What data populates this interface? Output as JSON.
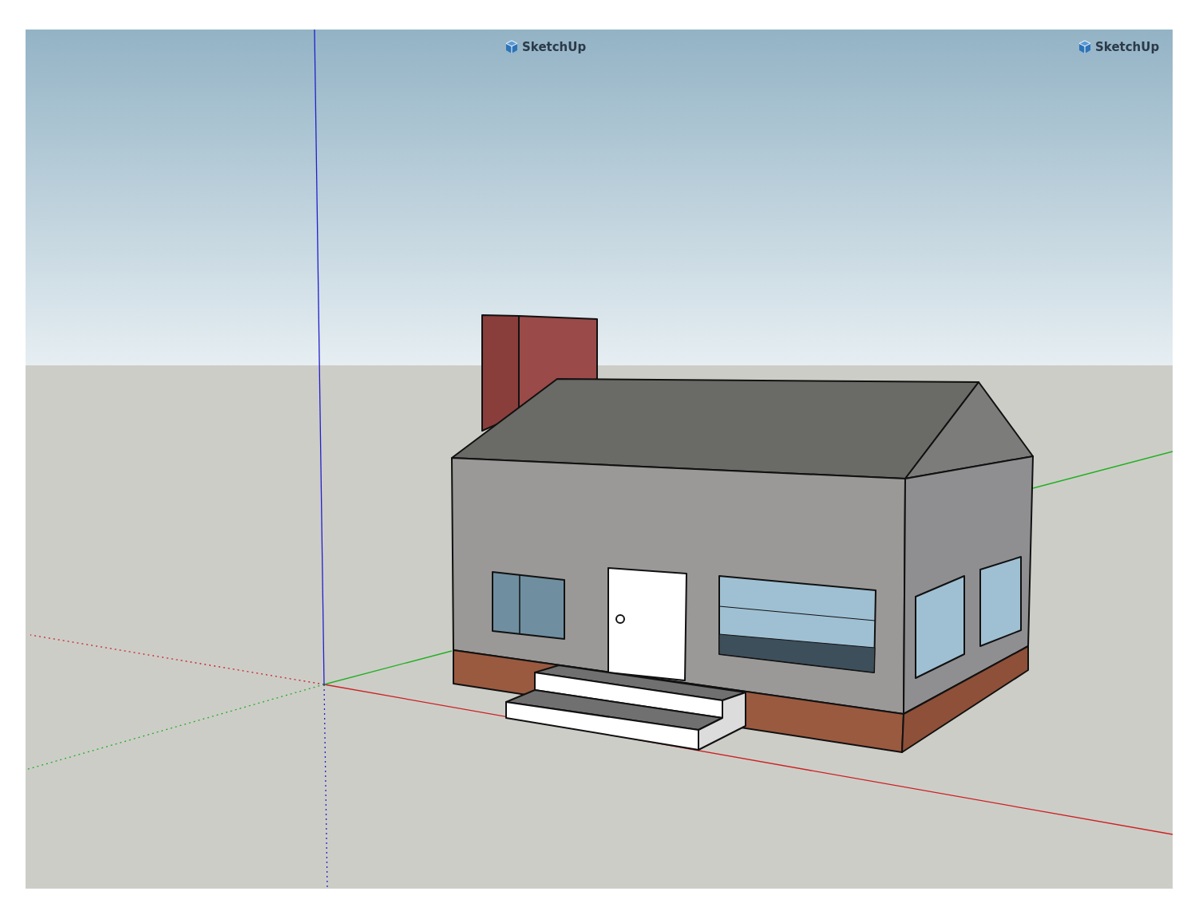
{
  "viewport": {
    "logos": [
      {
        "label": "SketchUp"
      },
      {
        "label": "SketchUp"
      }
    ]
  }
}
